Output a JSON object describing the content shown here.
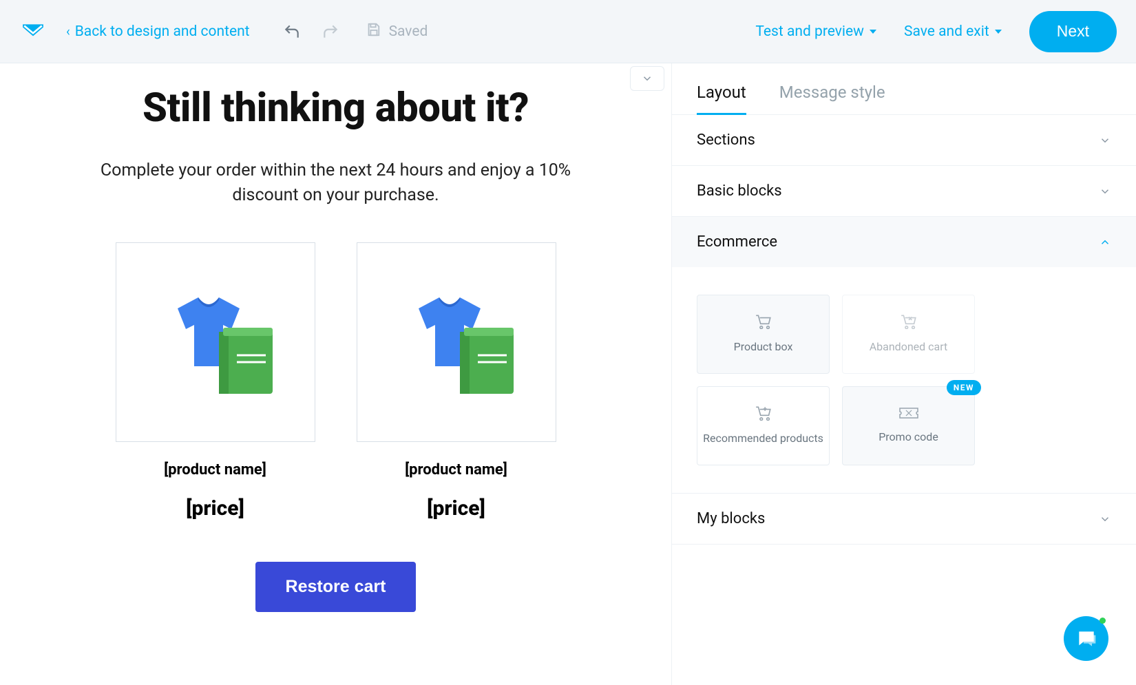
{
  "toolbar": {
    "back_label": "Back to design and content",
    "saved_label": "Saved",
    "test_preview_label": "Test and preview",
    "save_exit_label": "Save and exit",
    "next_label": "Next"
  },
  "canvas": {
    "headline": "Still thinking about it?",
    "subtext": "Complete your order within the next 24 hours and enjoy a 10% discount on your purchase.",
    "products": [
      {
        "name": "[product name]",
        "price": "[price]"
      },
      {
        "name": "[product name]",
        "price": "[price]"
      }
    ],
    "restore_label": "Restore cart"
  },
  "panel": {
    "tabs": {
      "layout": "Layout",
      "style": "Message style"
    },
    "sections_label": "Sections",
    "basic_label": "Basic blocks",
    "ecommerce_label": "Ecommerce",
    "myblocks_label": "My blocks",
    "blocks": {
      "product_box": "Product box",
      "abandoned_cart": "Abandoned cart",
      "recommended": "Recommended products",
      "promo_code": "Promo code",
      "new_badge": "NEW"
    }
  }
}
